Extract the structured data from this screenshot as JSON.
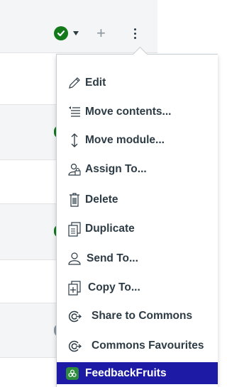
{
  "header": {
    "status_icon": "check-circle-icon",
    "status_color": "#127a1b",
    "add_icon": "+",
    "menu_icon": "kebab-icon"
  },
  "peek_colors": [
    "#127a1b",
    "#127a1b",
    "#8b969e"
  ],
  "menu": {
    "items": [
      {
        "label": "Edit",
        "icon": "pencil-icon"
      },
      {
        "label": "Move contents...",
        "icon": "move-contents-icon"
      },
      {
        "label": "Move module...",
        "icon": "move-vertical-icon"
      },
      {
        "label": "Assign To...",
        "icon": "assign-user-icon"
      },
      {
        "label": "Delete",
        "icon": "trash-icon"
      },
      {
        "label": "Duplicate",
        "icon": "duplicate-icon"
      },
      {
        "label": "Send To...",
        "icon": "send-user-icon"
      },
      {
        "label": "Copy To...",
        "icon": "copy-to-icon"
      },
      {
        "label": "Share to Commons",
        "icon": "commons-share-icon"
      },
      {
        "label": "Commons Favourites",
        "icon": "commons-favourites-icon"
      },
      {
        "label": "FeedbackFruits",
        "icon": "feedbackfruits-icon"
      }
    ],
    "highlight_color": "#1d1ba5"
  }
}
